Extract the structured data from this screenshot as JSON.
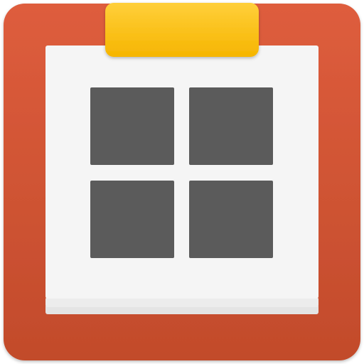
{
  "icon": {
    "name": "calendar-grid-app-icon",
    "colors": {
      "frame_top": "#de5d3d",
      "frame_bottom": "#c24b2b",
      "tab_top": "#ffcf3a",
      "tab_bottom": "#f6b500",
      "page": "#f5f5f5",
      "page_stack": "#e4e4e4",
      "tile": "#5b5b5b"
    }
  }
}
